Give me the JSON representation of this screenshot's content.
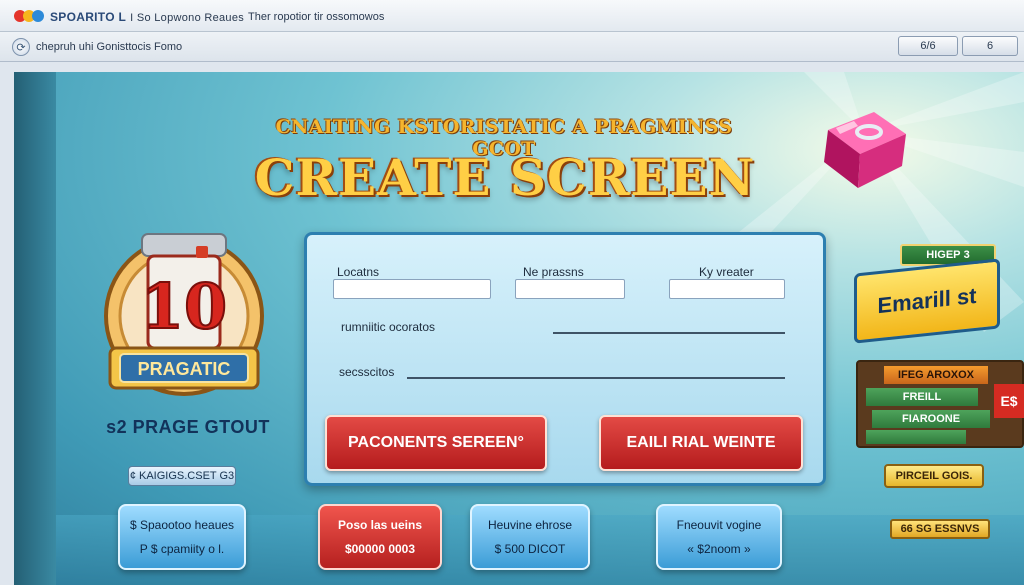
{
  "browser": {
    "brand": "SPOARITO L",
    "brand_rest": "I So Lopwono Reaues",
    "window_title": "Ther ropotior tir ossomowos",
    "address": "chepruh uhi Gonisttocis Fomo",
    "buttons": [
      "6/6",
      "6"
    ]
  },
  "headline": {
    "small": "CNAITING KSTORISTATIC A PRAGMINSS GCOT",
    "big": "CREATE SCREEN"
  },
  "emblem": {
    "number": "10",
    "plate": "PRAGATIC",
    "caption": "s2 PRAGE GTOUT"
  },
  "form": {
    "labels": [
      "Locatns",
      "Ne prassns",
      "Ky vreater"
    ],
    "line1_label": "rumniitic ocoratos",
    "line2_label": "secsscitos",
    "btn_left": "PACONENTS SEREEN°",
    "btn_right": "EAILI RIAL WEINTE"
  },
  "signs": {
    "top_tag": "HIGEP",
    "top_tag_num": "3",
    "email": "Emarill st",
    "board1": "IFEG AROXOX",
    "board2": "FREILL",
    "board3": "FIAROONE",
    "board_side": "E$",
    "gold_btn": "PIRCEIL GOIS.",
    "gold_bar": "66 SG ESSNVS"
  },
  "bottom": {
    "pill": "¢ KAIGIGS.CSET G3",
    "cards": [
      {
        "top": "$ Spaootoo heaues",
        "bottom": "P $ cpamiity o l."
      },
      {
        "top": "Poso las ueins",
        "bottom": "$00000 0003"
      },
      {
        "top": "Heuvine ehrose",
        "bottom": "$ 500 DICOT"
      },
      {
        "top": "Fneouvit vogine",
        "bottom": "« $2noom »"
      }
    ]
  }
}
